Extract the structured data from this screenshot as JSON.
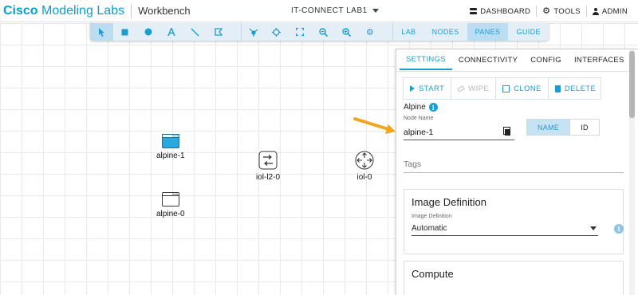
{
  "header": {
    "brand_bold": "Cisco",
    "brand_rest": " Modeling Labs",
    "app_title": "Workbench",
    "lab_name": "IT-CONNECT LAB1",
    "dashboard": "DASHBOARD",
    "tools": "TOOLS",
    "admin": "ADMIN"
  },
  "toolbar": {
    "nav": [
      "LAB",
      "NODES",
      "PANES",
      "GUIDE"
    ],
    "active_nav": "PANES"
  },
  "nodes": [
    {
      "label": "alpine-1",
      "kind": "server-selected"
    },
    {
      "label": "alpine-0",
      "kind": "server"
    },
    {
      "label": "iol-l2-0",
      "kind": "switch"
    },
    {
      "label": "iol-0",
      "kind": "router"
    }
  ],
  "panel": {
    "tabs": [
      "SETTINGS",
      "CONNECTIVITY",
      "CONFIG",
      "INTERFACES"
    ],
    "active_tab": "SETTINGS",
    "actions": {
      "start": "START",
      "wipe": "WIPE",
      "clone": "CLONE",
      "delete": "DELETE"
    },
    "node_type": "Alpine",
    "node_name_label": "Node Name",
    "node_name_value": "alpine-1",
    "toggle": {
      "name": "NAME",
      "id": "ID"
    },
    "tags_placeholder": "Tags",
    "image_definition": {
      "title": "Image Definition",
      "label": "Image Definition",
      "value": "Automatic"
    },
    "compute": {
      "title": "Compute"
    }
  },
  "colors": {
    "accent": "#1a9dd1",
    "brand": "#049fd9",
    "arrow": "#f2a51e",
    "toolbar_bg": "#e4eef6"
  }
}
